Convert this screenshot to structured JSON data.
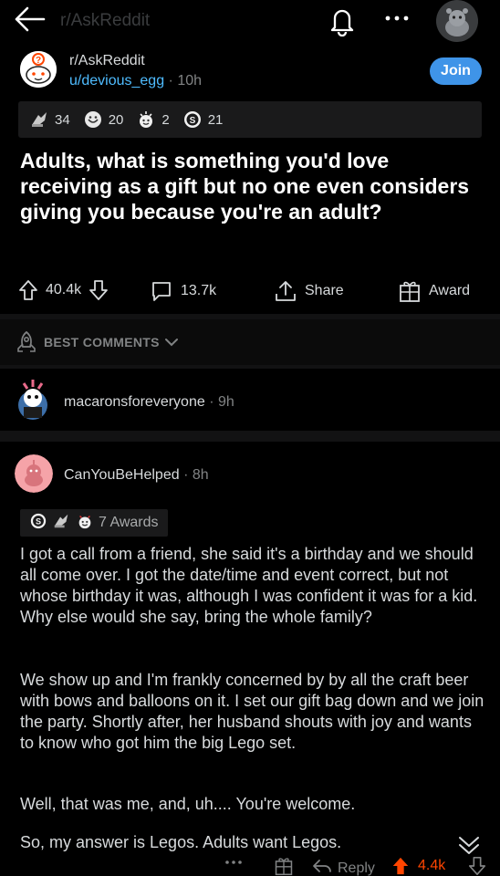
{
  "topbar": {
    "title": "r/AskReddit"
  },
  "post": {
    "subreddit": "r/AskReddit",
    "author": "u/devious_egg",
    "age": "10h",
    "join_label": "Join",
    "awards": [
      {
        "icon": "silver-award-icon",
        "count": "34"
      },
      {
        "icon": "helpful-award-icon",
        "count": "20"
      },
      {
        "icon": "wholesome-award-icon",
        "count": "2"
      },
      {
        "icon": "platinum-award-icon",
        "count": "21"
      }
    ],
    "title": "Adults, what is something you'd love receiving as a gift but no one even considers giving you because you're an adult?",
    "votes": "40.4k",
    "comments": "13.7k",
    "share_label": "Share",
    "award_label": "Award"
  },
  "sort": {
    "label": "BEST COMMENTS"
  },
  "comments": [
    {
      "user": "macaronsforeveryone",
      "age": "9h"
    },
    {
      "user": "CanYouBeHelped",
      "age": "8h",
      "awards_label": "7 Awards",
      "paragraphs": [
        "I got a call from a friend, she said it's a birthday and we should all come over. I got the date/time and event correct, but not whose birthday it was, although I was confident it was for a kid. Why else would she say, bring the whole family?",
        "We show up and I'm frankly concerned by by all the craft beer with bows and balloons on it. I set our gift bag down and we join the party. Shortly after, her husband shouts with joy and wants to know who got him the big Lego set.",
        "Well, that was me, and, uh.... You're welcome.",
        "So, my answer is Legos. Adults want Legos."
      ],
      "reply_label": "Reply",
      "score": "4.4k"
    }
  ],
  "colors": {
    "background": "#000000",
    "accent_blue": "#3f94e8",
    "link_blue": "#4fbcff",
    "upvote_orange": "#ff4500",
    "muted": "#818384"
  }
}
